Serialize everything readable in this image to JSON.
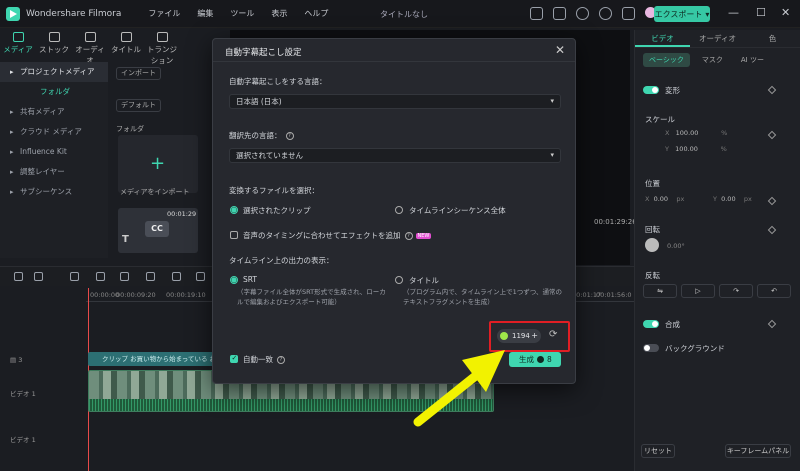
{
  "app": {
    "name": "Wondershare Filmora",
    "menu": [
      "ファイル",
      "編集",
      "ツール",
      "表示",
      "ヘルプ"
    ],
    "doc_title": "タイトルなし",
    "export_label": "エクスポート"
  },
  "toptabs": [
    "メディア",
    "ストック",
    "オーディオ",
    "タイトル",
    "トランジション"
  ],
  "sidebar": {
    "items": [
      "プロジェクトメディア",
      "フォルダ",
      "共有メディア",
      "クラウド メディア",
      "Influence Kit",
      "調整レイヤー",
      "サブシーケンス"
    ]
  },
  "media": {
    "import_chip": "インポート",
    "sort_chip": "デフォルト",
    "folder_label": "フォルダ",
    "import_label": "メディアをインポート",
    "thumb_time": "00:01:29"
  },
  "preview": {
    "time": "00:01:29:26"
  },
  "right_panel": {
    "tabs": [
      "ビデオ",
      "オーディオ",
      "色"
    ],
    "subtabs": [
      "ベーシック",
      "マスク",
      "AI ツー"
    ],
    "transform_label": "変形",
    "scale_label": "スケール",
    "scale_x": "100.00",
    "scale_y": "100.00",
    "pct": "%",
    "position_label": "位置",
    "pos_x": "0.00",
    "pos_y": "0.00",
    "px": "px",
    "rotation_label": "回転",
    "rotation_value": "0.00°",
    "flip_label": "反転",
    "composite_label": "合成",
    "background_label": "バックグラウンド",
    "reset_label": "リセット",
    "keyframe_label": "キーフレームパネル"
  },
  "timeline": {
    "ruler": [
      "00:00:00",
      "00:00:09:20",
      "00:00:19:10",
      "00:01:17",
      "00:01:56:0"
    ],
    "subtitle_text": "クリップ お買い物から始まっている お",
    "track_video": "ビデオ 1",
    "track_audio": "ビデオ 1"
  },
  "dialog": {
    "title": "自動字幕起こし設定",
    "lang_label": "自動字幕起こしをする言語：",
    "lang_value": "日本語 (日本)",
    "translate_label": "翻訳先の言語：",
    "translate_value": "選択されていません",
    "file_label": "変換するファイルを選択：",
    "opt_selected_clip": "選択されたクリップ",
    "opt_timeline_all": "タイムラインシーケンス全体",
    "sync_effect_label": "音声のタイミングに合わせてエフェクトを追加",
    "new_badge": "NEW",
    "output_label": "タイムライン上の出力の表示：",
    "opt_srt": "SRT",
    "srt_desc": "（字幕ファイル全体がSRT形式で生成され、ローカルで編集およびエクスポート可能）",
    "opt_title": "タイトル",
    "title_desc": "（プログラム内で、タイムライン上で1つずつ、通常のテキストフラグメントを生成）",
    "credits": "1194",
    "auto_match_label": "自動一致",
    "generate_label": "生成",
    "generate_cost": "8"
  },
  "colors": {
    "accent": "#3fd6b0",
    "highlight": "#e01e24",
    "arrow": "#f2f200"
  }
}
